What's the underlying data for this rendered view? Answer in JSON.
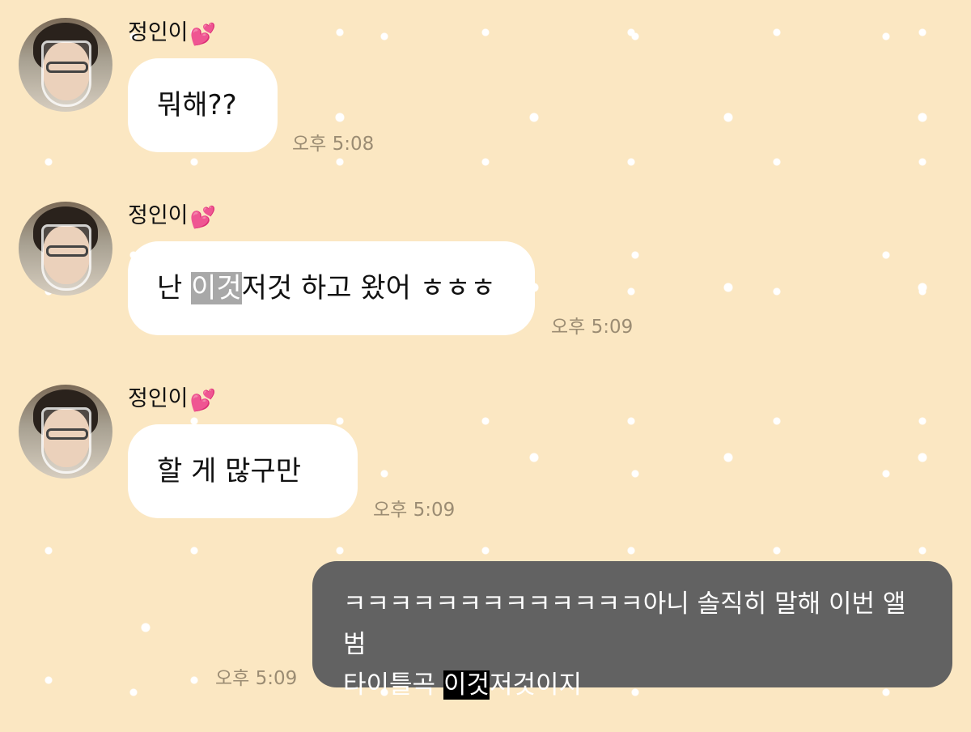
{
  "messages": [
    {
      "sender": "정인이",
      "sender_emoji": "💕",
      "avatar": "profile-photo-glass",
      "text": "뭐해??",
      "time": "오후 5:08"
    },
    {
      "sender": "정인이",
      "sender_emoji": "💕",
      "avatar": "profile-photo-glass",
      "text_before": "난 ",
      "text_highlight": "이것",
      "text_after": "저것 하고 왔어 ㅎㅎㅎ",
      "highlight_color": "#a8a8a8",
      "time": "오후 5:09"
    },
    {
      "sender": "정인이",
      "sender_emoji": "💕",
      "avatar": "profile-photo-glass",
      "text": "할 게 많구만",
      "time": "오후 5:09"
    }
  ],
  "sent_message": {
    "line1": "ㅋㅋㅋㅋㅋㅋㅋㅋㅋㅋㅋㅋㅋ아니 솔직히 말해 이번 앨범",
    "line2_before": "타이틀곡 ",
    "line2_highlight": "이것",
    "line2_after": "저것이지",
    "highlight_color": "#000000",
    "time": "오후 5:09"
  },
  "colors": {
    "background": "#fbe7c2",
    "received_bubble": "#ffffff",
    "sent_bubble": "#626262",
    "heart": "#ff4fb4",
    "timestamp": "#9b8c73"
  }
}
